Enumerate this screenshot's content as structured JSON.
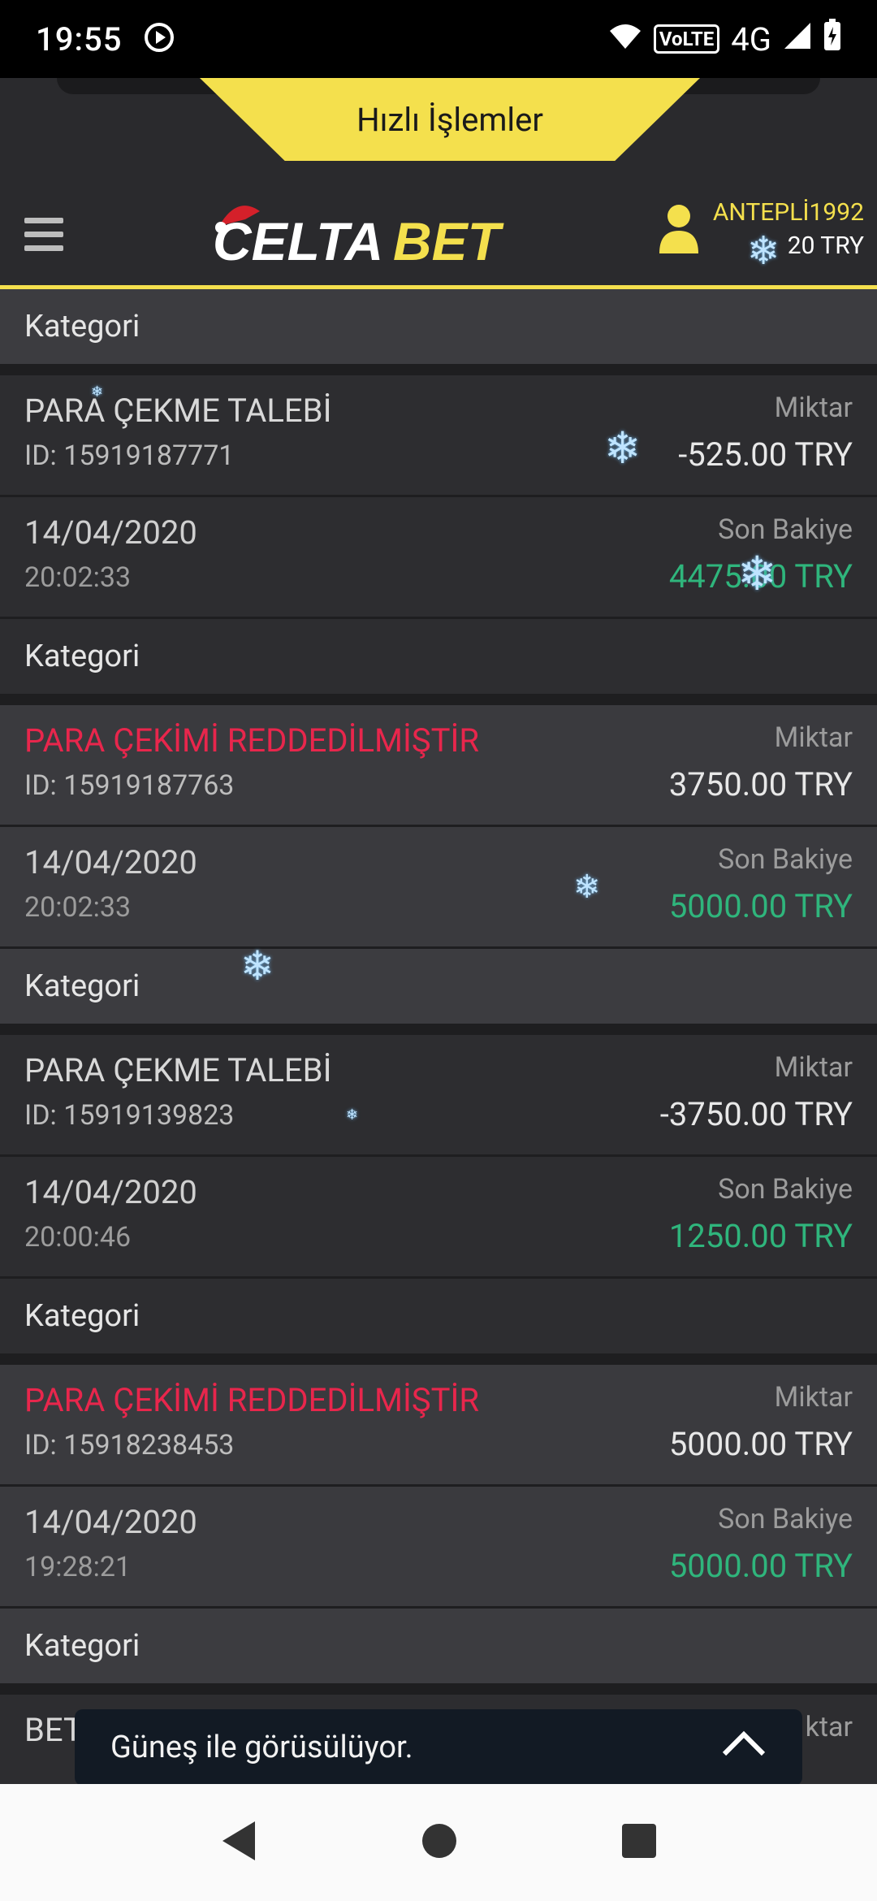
{
  "status": {
    "time": "19:55",
    "network": "4G",
    "volte": "VoLTE"
  },
  "header": {
    "quick_actions": "Hızlı İşlemler",
    "logo_text_1": "CELTA",
    "logo_text_2": "BET",
    "username": "ANTEPLİ1992",
    "balance": "20 TRY"
  },
  "transactions": [
    {
      "category": "Kategori",
      "title": "PARA ÇEKME TALEBİ",
      "status": "normal",
      "id": "ID: 15919187771",
      "amount_label": "Miktar",
      "amount": "-525.00 TRY",
      "date": "14/04/2020",
      "time": "20:02:33",
      "balance_label": "Son Bakiye",
      "balance": "4475.00 TRY"
    },
    {
      "category": "Kategori",
      "title": "PARA ÇEKİMİ REDDEDİLMİŞTİR",
      "status": "rejected",
      "id": "ID: 15919187763",
      "amount_label": "Miktar",
      "amount": "3750.00 TRY",
      "date": "14/04/2020",
      "time": "20:02:33",
      "balance_label": "Son Bakiye",
      "balance": "5000.00 TRY"
    },
    {
      "category": "Kategori",
      "title": "PARA ÇEKME TALEBİ",
      "status": "normal",
      "id": "ID: 15919139823",
      "amount_label": "Miktar",
      "amount": "-3750.00 TRY",
      "date": "14/04/2020",
      "time": "20:00:46",
      "balance_label": "Son Bakiye",
      "balance": "1250.00 TRY"
    },
    {
      "category": "Kategori",
      "title": "PARA ÇEKİMİ REDDEDİLMİŞTİR",
      "status": "rejected",
      "id": "ID: 15918238453",
      "amount_label": "Miktar",
      "amount": "5000.00 TRY",
      "date": "14/04/2020",
      "time": "19:28:21",
      "balance_label": "Son Bakiye",
      "balance": "5000.00 TRY"
    }
  ],
  "partial": {
    "category": "Kategori",
    "title_fragment": "BET",
    "amount_label_fragment": "ktar"
  },
  "chat": {
    "label": "Güneş ile görüsülüyor."
  },
  "colors": {
    "accent": "#f4e04d",
    "rejected": "#e8264c",
    "balance": "#2fb57c"
  }
}
